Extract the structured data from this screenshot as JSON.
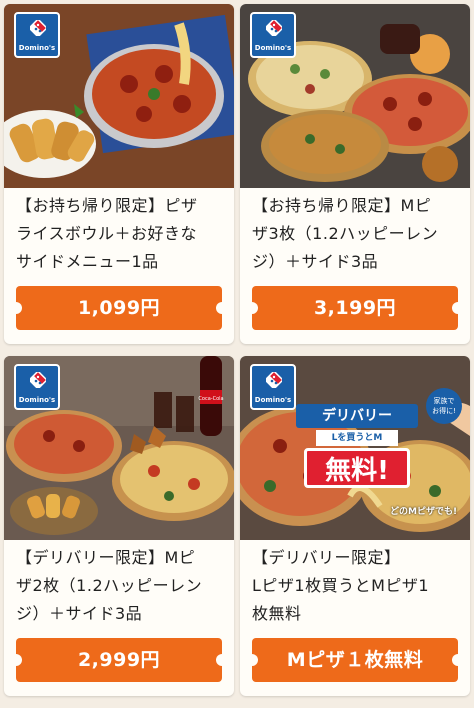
{
  "brand": {
    "logo_text": "Domino's",
    "color": "#1a5fa8"
  },
  "accent": "#ee6a1a",
  "cards": [
    {
      "desc_lines": [
        "【お持ち帰り限定】ピザ",
        "ライスボウル＋お好きな",
        "サイドメニュー1品"
      ],
      "price": "1,099円"
    },
    {
      "desc_lines": [
        "【お持ち帰り限定】Mピ",
        "ザ3枚（1.2ハッピーレン",
        "ジ）＋サイド3品"
      ],
      "price": "3,199円"
    },
    {
      "desc_lines": [
        "【デリバリー限定】Mピ",
        "ザ2枚（1.2ハッピーレン",
        "ジ）＋サイド3品"
      ],
      "price": "2,999円"
    },
    {
      "desc_lines": [
        "【デリバリー限定】",
        "Lピザ1枚買うとMピザ1",
        "枚無料"
      ],
      "price": "Mピザ１枚無料",
      "promo": {
        "top": "デリバリー",
        "mid": "Lを買うとM",
        "free": "無料!",
        "circle_line1": "家族で",
        "circle_line2": "お得に!",
        "bottom": "どのMピザでも!"
      }
    }
  ],
  "icons": {
    "logo": "dominoes-logo-icon",
    "bottle_label": "Coca-Cola"
  }
}
